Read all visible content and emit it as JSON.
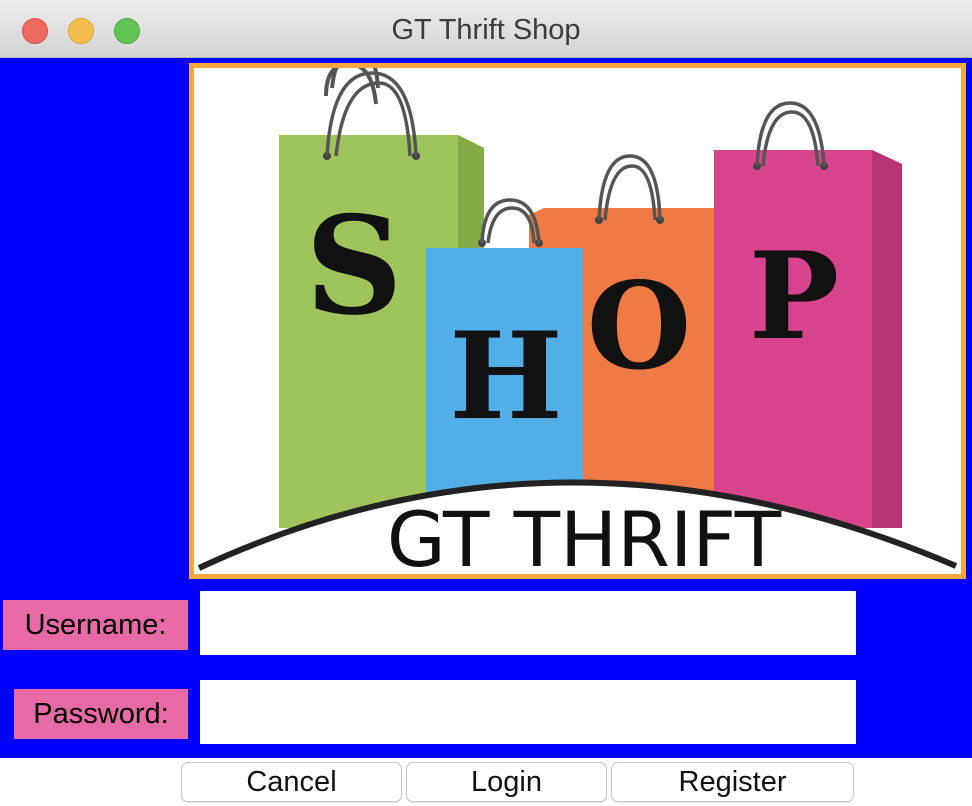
{
  "window": {
    "title": "GT Thrift Shop"
  },
  "logo": {
    "bag_letters": [
      "S",
      "H",
      "O",
      "P"
    ],
    "caption": "GT THRIFT",
    "colors": {
      "frame": "#f4a93c",
      "green_bag": "#9dc55b",
      "blue_bag": "#52aee6",
      "orange_bag": "#ef7a43",
      "pink_bag": "#d8458e"
    }
  },
  "form": {
    "username_label": "Username:",
    "username_value": "",
    "password_label": "Password:",
    "password_value": ""
  },
  "buttons": {
    "cancel": "Cancel",
    "login": "Login",
    "register": "Register"
  },
  "colors": {
    "background": "#0000fe",
    "label_bg": "#e76aa7"
  }
}
